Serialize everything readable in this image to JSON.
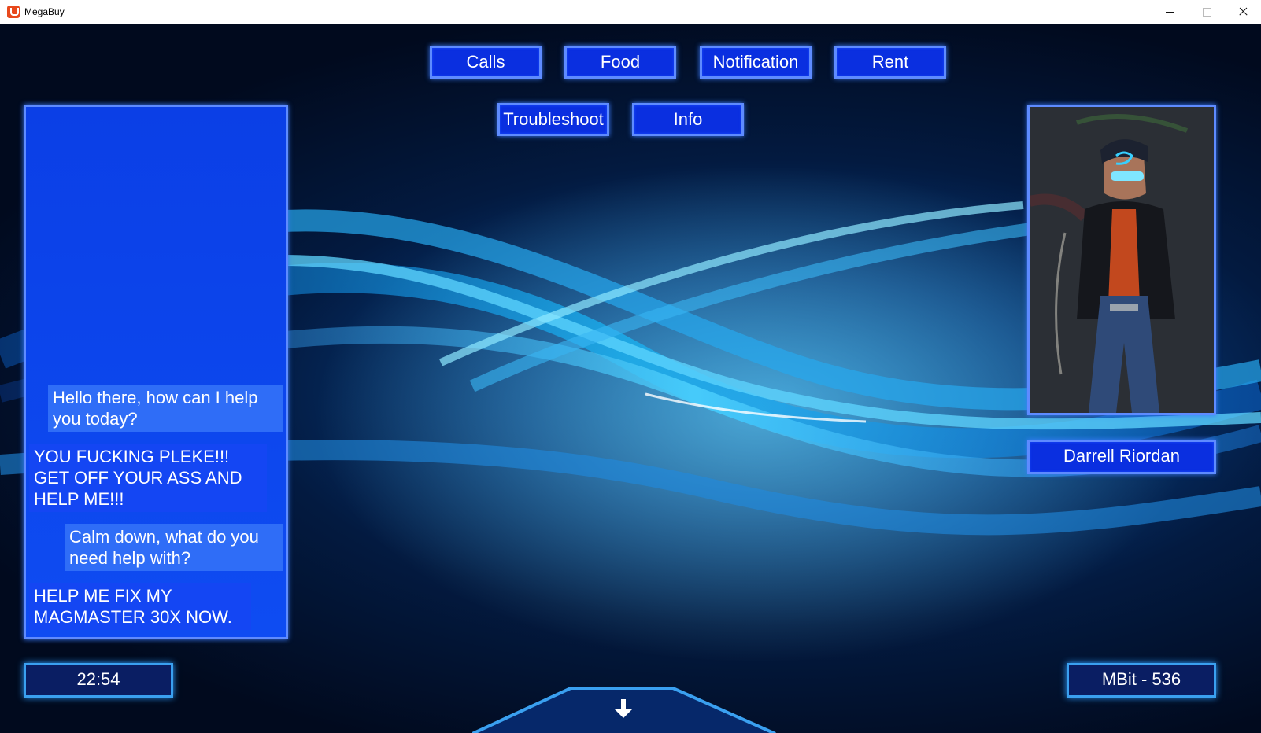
{
  "window": {
    "title": "MegaBuy"
  },
  "nav": {
    "calls": "Calls",
    "food": "Food",
    "notification": "Notification",
    "rent": "Rent",
    "troubleshoot": "Troubleshoot",
    "info": "Info"
  },
  "chat": {
    "messages": [
      {
        "sender": "agent",
        "text": "Hello there, how can I help you today?"
      },
      {
        "sender": "customer",
        "text": "YOU FUCKING PLEKE!!! GET OFF YOUR ASS AND HELP ME!!!"
      },
      {
        "sender": "agent",
        "text": "Calm down, what do you need help with?"
      },
      {
        "sender": "customer",
        "text": "HELP ME FIX MY MAGMASTER 30X NOW."
      }
    ]
  },
  "caller": {
    "name": "Darrell Riordan"
  },
  "status": {
    "time": "22:54",
    "mbit": "MBit - 536"
  },
  "icons": {
    "scroll_down": "arrow-down-icon",
    "app": "megabuy-app-icon"
  },
  "colors": {
    "button_fill": "#0a2fe0",
    "button_border": "#5e8bff",
    "accent": "#2f6df7"
  }
}
